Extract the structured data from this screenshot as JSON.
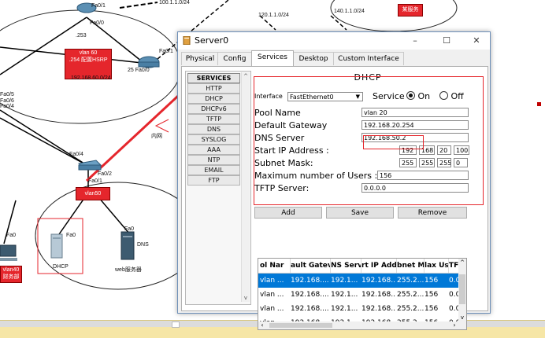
{
  "window": {
    "title": "Server0",
    "controls": {
      "minimize": "–",
      "maximize": "☐",
      "close": "✕"
    },
    "tabs": [
      {
        "label": "Physical"
      },
      {
        "label": "Config"
      },
      {
        "label": "Services"
      },
      {
        "label": "Desktop"
      },
      {
        "label": "Custom Interface"
      }
    ],
    "active_tab": "Services"
  },
  "services": {
    "header": "SERVICES",
    "items": [
      "HTTP",
      "DHCP",
      "DHCPv6",
      "TFTP",
      "DNS",
      "SYSLOG",
      "AAA",
      "NTP",
      "EMAIL",
      "FTP"
    ]
  },
  "dhcp": {
    "title": "DHCP",
    "interface_label": "Interface",
    "interface_value": "FastEthernet0",
    "service_label": "Service",
    "on_label": "On",
    "off_label": "Off",
    "service_state": "On",
    "pool_name_label": "Pool Name",
    "pool_name_value": "vlan 20",
    "gateway_label": "Default Gateway",
    "gateway_value": "192.168.20.254",
    "dns_label": "DNS Server",
    "dns_value": "192.168.50.2",
    "start_ip_label": "Start IP Address :",
    "start_ip": [
      "192",
      "168",
      "20",
      "100"
    ],
    "subnet_label": "Subnet Mask:",
    "subnet": [
      "255",
      "255",
      "255",
      "0"
    ],
    "max_users_label": "Maximum number of Users :",
    "max_users_value": "156",
    "tftp_label": "TFTP Server:",
    "tftp_value": "0.0.0.0",
    "add_button": "Add",
    "save_button": "Save",
    "remove_button": "Remove"
  },
  "pool_table": {
    "columns": [
      "ol Nar",
      "ault Gatev",
      "NS Serv",
      "rt IP Addr",
      "bnet M",
      "lax Us",
      "TF"
    ],
    "rows": [
      [
        "vlan ...",
        "192.168....",
        "192.1...",
        "192.168...",
        "255.2...",
        "156",
        "0.0"
      ],
      [
        "vlan ...",
        "192.168....",
        "192.1...",
        "192.168...",
        "255.2...",
        "156",
        "0.0"
      ],
      [
        "vlan ...",
        "192.168....",
        "192.1...",
        "192.168...",
        "255.2...",
        "156",
        "0.0"
      ],
      [
        "vlan ...",
        "192.168....",
        "192.1...",
        "192.168...",
        "255.2...",
        "156",
        "0.0"
      ]
    ]
  },
  "topology": {
    "labels": {
      "fa01_top": "Fa0/1",
      "fa00_top": "Fa0/0",
      "net_100": "100.1.1.0/24",
      "dot253": ".253",
      "net_120": "120.1.1.0/24",
      "net_140": "140.1.1.0/24",
      "vlan60": "vlan 60",
      "vlan60_hsrp": ".254 配置HSRP",
      "net_60": "192.168.60.0/24",
      "r2_fa01": "Fa0/1",
      "r2_fa00": "25 Fa0/0",
      "fa05": "Fa0/5",
      "fa06": "Fa0/6",
      "fa04": "Fa0/4",
      "sw_fa04": "Fa0/4",
      "sw_fa02": "Fa0/2",
      "sw_fa01": "Fa0/1",
      "vlan50": "vlan50",
      "inner_net": "内网",
      "dhcp_fa0": "Fa0",
      "dns_fa0": "Fa0",
      "pc_fa0": "Fa0",
      "dhcp_host": "DHCP",
      "dns_label": "DNS",
      "web_server": "web服务器",
      "vlan40": "vlan40",
      "finance": "财务部",
      "isp_label": "某服务"
    }
  }
}
